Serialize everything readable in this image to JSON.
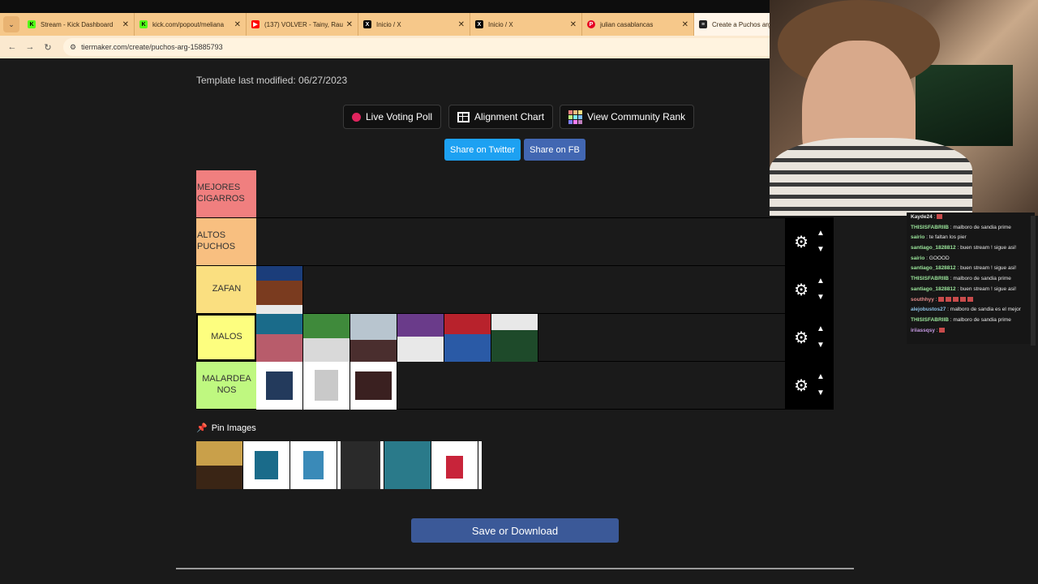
{
  "browser": {
    "tabs": [
      {
        "title": "Stream - Kick Dashboard",
        "icon": "kick-icon",
        "active": false
      },
      {
        "title": "kick.com/popout/meliana",
        "icon": "kick-icon",
        "active": false
      },
      {
        "title": "(137) VOLVER - Tainy, Rau",
        "icon": "youtube-icon",
        "active": false
      },
      {
        "title": "Inicio / X",
        "icon": "x-icon",
        "active": false
      },
      {
        "title": "Inicio / X",
        "icon": "x-icon",
        "active": false
      },
      {
        "title": "julian casablancas",
        "icon": "pinterest-icon",
        "active": false
      },
      {
        "title": "Create a Puchos arg",
        "icon": "tiermaker-icon",
        "active": true
      }
    ],
    "url": "tiermaker.com/create/puchos-arg-15885793"
  },
  "page": {
    "modified": "Template last modified: 06/27/2023",
    "buttons": {
      "live_poll": "Live Voting Poll",
      "alignment": "Alignment Chart",
      "community": "View Community Rank",
      "share_twitter": "Share on Twitter",
      "share_fb": "Share on FB"
    },
    "tiers": [
      {
        "label": "MEJORES CIGARROS",
        "color": "#f07f7f",
        "align": "left",
        "items": 0
      },
      {
        "label": "ALTOS PUCHOS",
        "color": "#f8bf80",
        "align": "left",
        "items": 0
      },
      {
        "label": "ZAFAN",
        "color": "#fadf80",
        "align": "center",
        "items": 1
      },
      {
        "label": "MALOS",
        "color": "#fdfe7f",
        "align": "center",
        "items": 6
      },
      {
        "label": "MALARDEANOS",
        "color": "#bff880",
        "align": "center",
        "items": 3
      }
    ],
    "tier_labels": {
      "t1": "MEJORES CIGARROS",
      "t2": "ALTOS PUCHOS",
      "t3": "ZAFAN",
      "t4": "MALOS",
      "t5": "MALARDEA NOS"
    },
    "pin_images": "Pin Images",
    "save": "Save or Download"
  },
  "chat": [
    {
      "user": "Kayde24",
      "text": " : ",
      "color": "#e8e8e8",
      "emotes": 1
    },
    {
      "user": "THISISFABRIIB",
      "text": " : malboro de sandia prime",
      "color": "#9be59b",
      "emotes": 0
    },
    {
      "user": "sairio",
      "text": " : te faltan los pier",
      "color": "#9be59b",
      "emotes": 0
    },
    {
      "user": "santiago_1828812",
      "text": " : buen stream ! sigue asi!",
      "color": "#9be59b",
      "emotes": 0
    },
    {
      "user": "sairio",
      "text": " : GOOOD",
      "color": "#9be59b",
      "emotes": 0
    },
    {
      "user": "santiago_1828812",
      "text": " : buen stream ! sigue asi!",
      "color": "#9be59b",
      "emotes": 0
    },
    {
      "user": "THISISFABRIIB",
      "text": " : malboro de sandia prime",
      "color": "#9be59b",
      "emotes": 0
    },
    {
      "user": "santiago_1828812",
      "text": " : buen stream ! sigue asi!",
      "color": "#9be59b",
      "emotes": 0
    },
    {
      "user": "southhyy",
      "text": " : ",
      "color": "#e58b8b",
      "emotes": 5
    },
    {
      "user": "alejobustos27",
      "text": " : malboro de sandia es el mejor",
      "color": "#8bc0e5",
      "emotes": 0
    },
    {
      "user": "THISISFABRIIB",
      "text": " : malboro de sandia prime",
      "color": "#9be59b",
      "emotes": 0
    },
    {
      "user": "iriiassqsy",
      "text": " : ",
      "color": "#c79be5",
      "emotes": 1
    }
  ],
  "colors": {
    "twitter": "#1da1f2",
    "facebook": "#4267b2",
    "save": "#3b5998",
    "tab_bar": "#f6c88a"
  }
}
